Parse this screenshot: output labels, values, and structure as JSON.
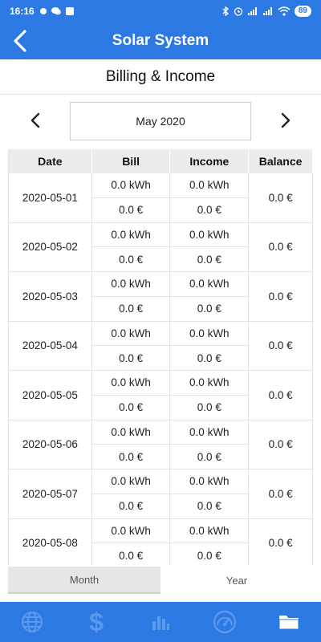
{
  "status": {
    "time": "16:16",
    "battery": "89"
  },
  "header": {
    "title": "Solar System"
  },
  "subheader": {
    "title": "Billing & Income"
  },
  "month_picker": {
    "value": "May 2020"
  },
  "table": {
    "columns": [
      "Date",
      "Bill",
      "Income",
      "Balance"
    ],
    "rows": [
      {
        "date": "2020-05-01",
        "bill_kwh": "0.0 kWh",
        "bill_eur": "0.0 €",
        "income_kwh": "0.0 kWh",
        "income_eur": "0.0 €",
        "balance": "0.0 €"
      },
      {
        "date": "2020-05-02",
        "bill_kwh": "0.0 kWh",
        "bill_eur": "0.0 €",
        "income_kwh": "0.0 kWh",
        "income_eur": "0.0 €",
        "balance": "0.0 €"
      },
      {
        "date": "2020-05-03",
        "bill_kwh": "0.0 kWh",
        "bill_eur": "0.0 €",
        "income_kwh": "0.0 kWh",
        "income_eur": "0.0 €",
        "balance": "0.0 €"
      },
      {
        "date": "2020-05-04",
        "bill_kwh": "0.0 kWh",
        "bill_eur": "0.0 €",
        "income_kwh": "0.0 kWh",
        "income_eur": "0.0 €",
        "balance": "0.0 €"
      },
      {
        "date": "2020-05-05",
        "bill_kwh": "0.0 kWh",
        "bill_eur": "0.0 €",
        "income_kwh": "0.0 kWh",
        "income_eur": "0.0 €",
        "balance": "0.0 €"
      },
      {
        "date": "2020-05-06",
        "bill_kwh": "0.0 kWh",
        "bill_eur": "0.0 €",
        "income_kwh": "0.0 kWh",
        "income_eur": "0.0 €",
        "balance": "0.0 €"
      },
      {
        "date": "2020-05-07",
        "bill_kwh": "0.0 kWh",
        "bill_eur": "0.0 €",
        "income_kwh": "0.0 kWh",
        "income_eur": "0.0 €",
        "balance": "0.0 €"
      },
      {
        "date": "2020-05-08",
        "bill_kwh": "0.0 kWh",
        "bill_eur": "0.0 €",
        "income_kwh": "0.0 kWh",
        "income_eur": "0.0 €",
        "balance": "0.0 €"
      }
    ]
  },
  "segment": {
    "month_label": "Month",
    "year_label": "Year",
    "selected": "Month"
  },
  "bottom_nav": {
    "items": [
      {
        "icon": "globe-icon"
      },
      {
        "icon": "dollar-icon"
      },
      {
        "icon": "bar-chart-icon"
      },
      {
        "icon": "gauge-icon"
      },
      {
        "icon": "folder-icon",
        "active": true
      }
    ]
  },
  "colors": {
    "primary": "#2d79e4",
    "nav_icon_inactive": "#5a99ee",
    "nav_icon_active": "#ffffff"
  }
}
